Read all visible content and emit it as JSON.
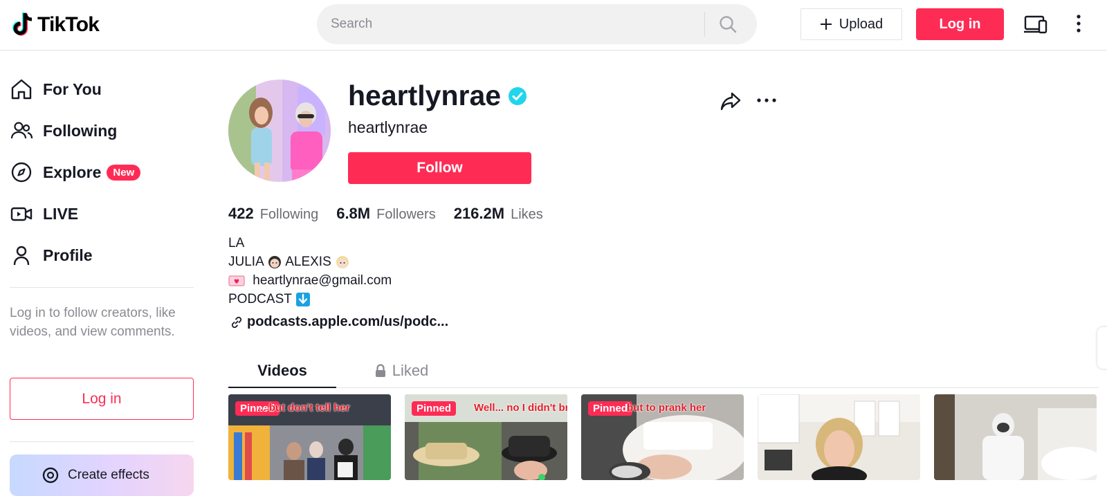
{
  "header": {
    "logo_text": "TikTok",
    "search_placeholder": "Search",
    "upload_label": "Upload",
    "login_label": "Log in"
  },
  "sidebar": {
    "items": [
      {
        "label": "For You",
        "icon": "home-icon"
      },
      {
        "label": "Following",
        "icon": "users-icon"
      },
      {
        "label": "Explore",
        "icon": "compass-icon",
        "badge": "New"
      },
      {
        "label": "LIVE",
        "icon": "live-video-icon"
      },
      {
        "label": "Profile",
        "icon": "person-icon"
      }
    ],
    "login_hint": "Log in to follow creators, like videos, and view comments.",
    "login_label": "Log in",
    "effects_label": "Create effects"
  },
  "profile": {
    "username": "heartlynrae",
    "subtitle": "heartlynrae",
    "verified": true,
    "follow_label": "Follow",
    "stats": [
      {
        "value": "422",
        "label": "Following"
      },
      {
        "value": "6.8M",
        "label": "Followers"
      },
      {
        "value": "216.2M",
        "label": "Likes"
      }
    ],
    "bio": {
      "line1": "LA",
      "line2_a": "JULIA",
      "line2_b": "ALEXIS",
      "email": "heartlynrae@gmail.com",
      "line4": "PODCAST"
    },
    "link": "podcasts.apple.com/us/podc..."
  },
  "tabs": {
    "videos": "Videos",
    "liked": "Liked"
  },
  "videos": [
    {
      "pinned": "Pinned",
      "overlay": "... but don't tell her"
    },
    {
      "pinned": "Pinned",
      "overlay": "Well... no I didn't bro"
    },
    {
      "pinned": "Pinned",
      "overlay": "but to prank her"
    },
    {
      "pinned": "",
      "overlay": ""
    },
    {
      "pinned": "",
      "overlay": ""
    }
  ],
  "colors": {
    "brand": "#fe2c55",
    "verified": "#20d5ec",
    "text": "#161823",
    "muted": "#8a8b91"
  }
}
